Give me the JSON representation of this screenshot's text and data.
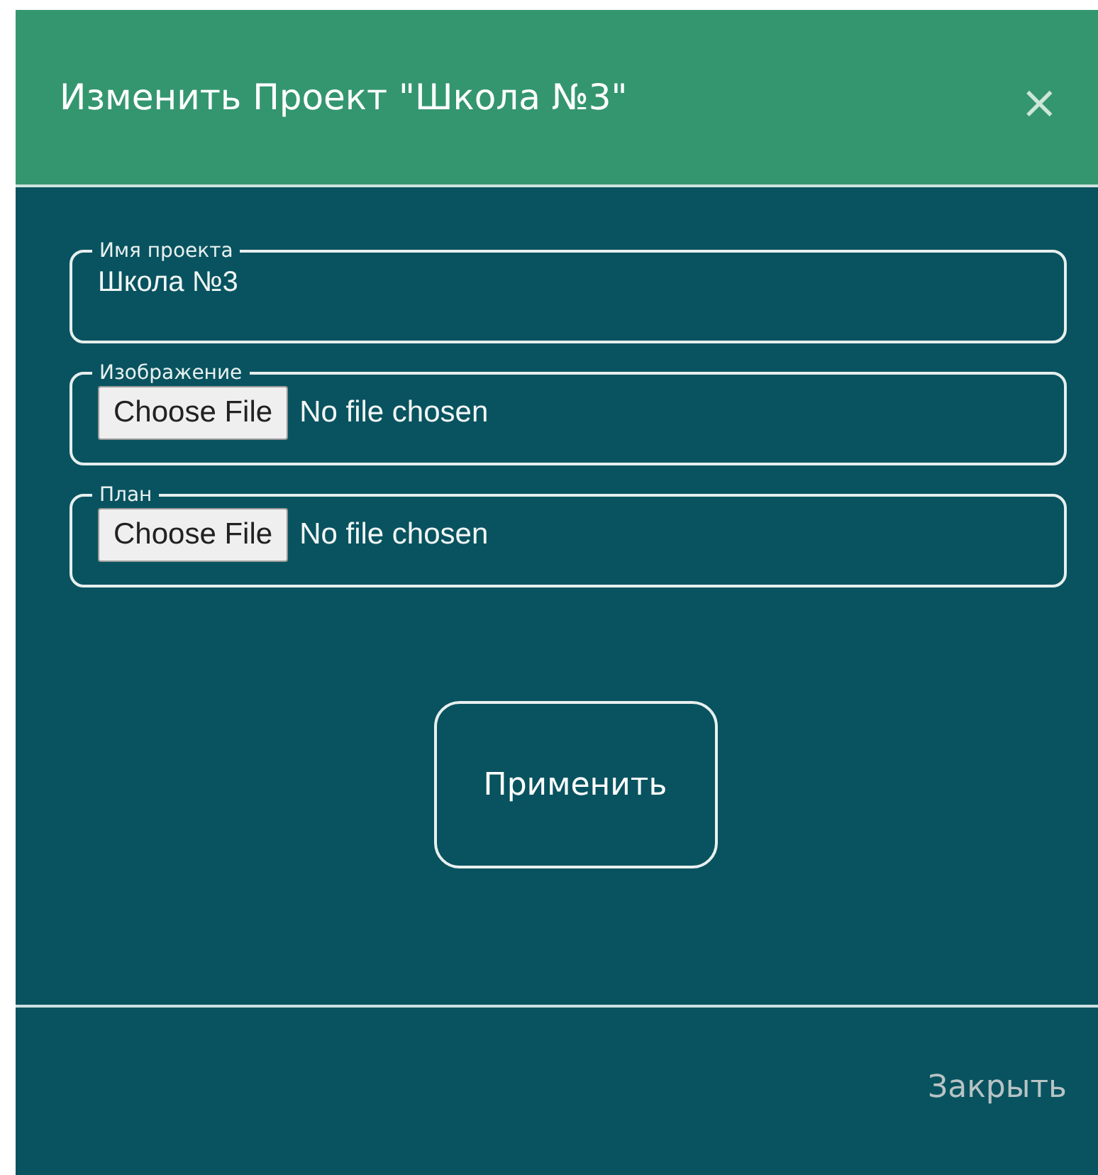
{
  "dialog": {
    "title": "Изменить Проект \"Школа №3\"",
    "close_icon": "×"
  },
  "fields": [
    {
      "kind": "text",
      "legend": "Имя проекта",
      "value": "Школа №3"
    },
    {
      "kind": "file",
      "legend": "Изображение",
      "button": "Choose File",
      "status": "No file chosen"
    },
    {
      "kind": "file",
      "legend": "План",
      "button": "Choose File",
      "status": "No file chosen"
    }
  ],
  "apply_button": "Применить",
  "footer": {
    "close_link": "Закрыть"
  }
}
